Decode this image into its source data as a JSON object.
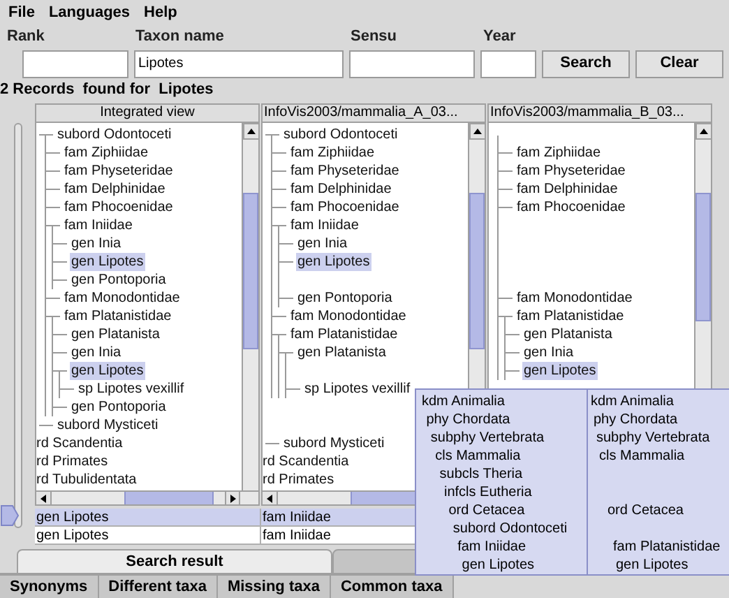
{
  "menu": [
    "File",
    "Languages",
    "Help"
  ],
  "search_form": {
    "fields": [
      {
        "label": "Rank"
      },
      {
        "label": "Taxon name",
        "value": "Lipotes"
      },
      {
        "label": "Sensu"
      },
      {
        "label": "Year"
      }
    ],
    "buttons": [
      "Search",
      "Clear"
    ]
  },
  "result_caption": "2 Records  found for  Lipotes",
  "panels": [
    {
      "title": "Integrated view",
      "tree": [
        {
          "kind": "node",
          "label": "subord Odontoceti",
          "selected": false,
          "children": [
            {
              "kind": "node",
              "label": "fam Ziphiidae",
              "selected": false
            },
            {
              "kind": "node",
              "label": "fam Physeteridae",
              "selected": false
            },
            {
              "kind": "node",
              "label": "fam Delphinidae",
              "selected": false
            },
            {
              "kind": "node",
              "label": "fam Phocoenidae",
              "selected": false
            },
            {
              "kind": "node",
              "label": "fam Iniidae",
              "selected": false,
              "children": [
                {
                  "kind": "node",
                  "label": "gen Inia",
                  "selected": false
                },
                {
                  "kind": "node",
                  "label": "gen Lipotes",
                  "selected": true
                },
                {
                  "kind": "node",
                  "label": "gen Pontoporia",
                  "selected": false
                }
              ]
            },
            {
              "kind": "node",
              "label": "fam Monodontidae",
              "selected": false
            },
            {
              "kind": "node",
              "label": "fam Platanistidae",
              "selected": false,
              "children": [
                {
                  "kind": "node",
                  "label": "gen Platanista",
                  "selected": false
                },
                {
                  "kind": "node",
                  "label": "gen Inia",
                  "selected": false
                },
                {
                  "kind": "node",
                  "label": "gen Lipotes",
                  "selected": true,
                  "children": [
                    {
                      "kind": "node",
                      "label": "sp Lipotes vexillif",
                      "selected": false
                    }
                  ]
                },
                {
                  "kind": "node",
                  "label": "gen Pontoporia",
                  "selected": false
                }
              ]
            }
          ]
        },
        {
          "kind": "node",
          "label": "subord Mysticeti",
          "selected": false
        },
        {
          "kind": "clipped",
          "label": "rd Scandentia",
          "selected": false
        },
        {
          "kind": "clipped",
          "label": "rd Primates",
          "selected": false
        },
        {
          "kind": "clipped",
          "label": "rd Tubulidentata",
          "selected": false
        }
      ]
    },
    {
      "title": "InfoVis2003/mammalia_A_03...",
      "tree": [
        {
          "kind": "node",
          "label": "subord Odontoceti",
          "selected": false,
          "children": [
            {
              "kind": "node",
              "label": "fam Ziphiidae",
              "selected": false
            },
            {
              "kind": "node",
              "label": "fam Physeteridae",
              "selected": false
            },
            {
              "kind": "node",
              "label": "fam Delphinidae",
              "selected": false
            },
            {
              "kind": "node",
              "label": "fam Phocoenidae",
              "selected": false
            },
            {
              "kind": "node",
              "label": "fam Iniidae",
              "selected": false,
              "children": [
                {
                  "kind": "node",
                  "label": "gen Inia",
                  "selected": false
                },
                {
                  "kind": "node",
                  "label": "gen Lipotes",
                  "selected": true
                },
                {
                  "kind": "gap"
                },
                {
                  "kind": "node",
                  "label": "gen Pontoporia",
                  "selected": false
                }
              ]
            },
            {
              "kind": "node",
              "label": "fam Monodontidae",
              "selected": false
            },
            {
              "kind": "node",
              "label": "fam Platanistidae",
              "selected": false,
              "children": [
                {
                  "kind": "node",
                  "label": "gen Platanista",
                  "selected": false,
                  "children": [
                    {
                      "kind": "gap"
                    },
                    {
                      "kind": "node",
                      "label": "sp Lipotes vexillif",
                      "selected": false
                    }
                  ]
                }
              ]
            }
          ]
        },
        {
          "kind": "gap"
        },
        {
          "kind": "gap"
        },
        {
          "kind": "node",
          "label": "subord Mysticeti",
          "selected": false
        },
        {
          "kind": "clipped",
          "label": "rd Scandentia",
          "selected": false
        },
        {
          "kind": "clipped",
          "label": "rd Primates",
          "selected": false
        }
      ]
    },
    {
      "title": "InfoVis2003/mammalia_B_03...",
      "tree": [
        {
          "kind": "gap",
          "children": [
            {
              "kind": "node",
              "label": "fam Ziphiidae",
              "selected": false
            },
            {
              "kind": "node",
              "label": "fam Physeteridae",
              "selected": false
            },
            {
              "kind": "node",
              "label": "fam Delphinidae",
              "selected": false
            },
            {
              "kind": "node",
              "label": "fam Phocoenidae",
              "selected": false
            },
            {
              "kind": "gap"
            },
            {
              "kind": "gap"
            },
            {
              "kind": "gap"
            },
            {
              "kind": "gap"
            },
            {
              "kind": "node",
              "label": "fam Monodontidae",
              "selected": false
            },
            {
              "kind": "node",
              "label": "fam Platanistidae",
              "selected": false,
              "children": [
                {
                  "kind": "node",
                  "label": "gen Platanista",
                  "selected": false
                },
                {
                  "kind": "node",
                  "label": "gen Inia",
                  "selected": false
                },
                {
                  "kind": "node",
                  "label": "gen Lipotes",
                  "selected": true
                }
              ]
            }
          ]
        }
      ]
    }
  ],
  "results": [
    {
      "cells": [
        "gen Lipotes",
        "fam Iniidae"
      ],
      "selected": true
    },
    {
      "cells": [
        "gen Lipotes",
        "fam Iniidae"
      ],
      "selected": false
    }
  ],
  "tabs": [
    {
      "label": "Search result",
      "selected": true
    },
    {
      "selected": false
    }
  ],
  "bottom_tabs": [
    {
      "label": "Synonyms",
      "selected": false
    },
    {
      "label": "Different taxa",
      "selected": false
    },
    {
      "label": "Missing taxa",
      "selected": false
    },
    {
      "label": "Common taxa",
      "selected": false
    }
  ],
  "lineage_popup": [
    {
      "ranks": [
        {
          "kind": "taxon",
          "label": "kdm Animalia"
        },
        {
          "kind": "taxon",
          "label": "phy Chordata"
        },
        {
          "kind": "taxon",
          "label": "subphy Vertebrata"
        },
        {
          "kind": "taxon",
          "label": "cls Mammalia"
        },
        {
          "kind": "taxon",
          "label": "subcls Theria"
        },
        {
          "kind": "taxon",
          "label": "infcls Eutheria"
        },
        {
          "kind": "taxon",
          "label": "ord Cetacea"
        },
        {
          "kind": "taxon",
          "label": "subord Odontoceti"
        },
        {
          "kind": "taxon",
          "label": "fam Iniidae"
        },
        {
          "kind": "taxon",
          "label": "gen Lipotes"
        }
      ]
    },
    {
      "ranks": [
        {
          "kind": "taxon",
          "label": "kdm Animalia"
        },
        {
          "kind": "taxon",
          "label": "phy Chordata"
        },
        {
          "kind": "taxon",
          "label": "subphy Vertebrata"
        },
        {
          "kind": "taxon",
          "label": "cls Mammalia"
        },
        {
          "kind": "gap"
        },
        {
          "kind": "gap"
        },
        {
          "kind": "taxon",
          "label": "ord Cetacea"
        },
        {
          "kind": "gap"
        },
        {
          "kind": "taxon",
          "label": "fam Platanistidae"
        },
        {
          "kind": "taxon",
          "label": "gen Lipotes"
        }
      ]
    }
  ]
}
